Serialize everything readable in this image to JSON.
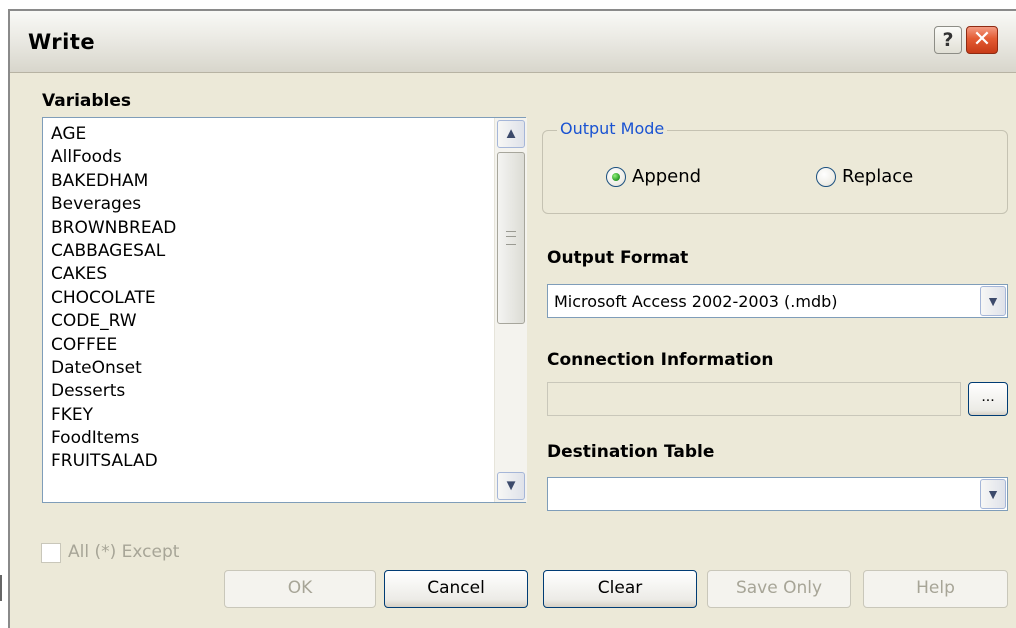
{
  "window": {
    "title": "Write",
    "help_glyph": "?",
    "close_glyph": "✕"
  },
  "variables": {
    "label": "Variables",
    "items": [
      "AGE",
      "AllFoods",
      "BAKEDHAM",
      "Beverages",
      "BROWNBREAD",
      "CABBAGESAL",
      "CAKES",
      "CHOCOLATE",
      "CODE_RW",
      "COFFEE",
      "DateOnset",
      "Desserts",
      "FKEY",
      "FoodItems",
      "FRUITSALAD"
    ],
    "scroll_up_icon": "▲",
    "scroll_down_icon": "▼"
  },
  "output_mode": {
    "legend": "Output Mode",
    "options": [
      "Append",
      "Replace"
    ],
    "selected": "Append"
  },
  "output_format": {
    "label": "Output Format",
    "value": "Microsoft Access 2002-2003 (.mdb)"
  },
  "connection": {
    "label": "Connection Information",
    "value": "",
    "browse_label": "..."
  },
  "destination": {
    "label": "Destination Table",
    "value": ""
  },
  "all_except": {
    "label": "All (*) Except",
    "checked": false,
    "enabled": false
  },
  "buttons": {
    "ok": "OK",
    "cancel": "Cancel",
    "clear": "Clear",
    "save_only": "Save Only",
    "help": "Help"
  },
  "colors": {
    "dialog_bg": "#ECE9D8",
    "group_legend": "#1a53d2",
    "close_red": "#e35b33",
    "radio_green": "#33a42e",
    "disabled_text": "#a7a597"
  }
}
